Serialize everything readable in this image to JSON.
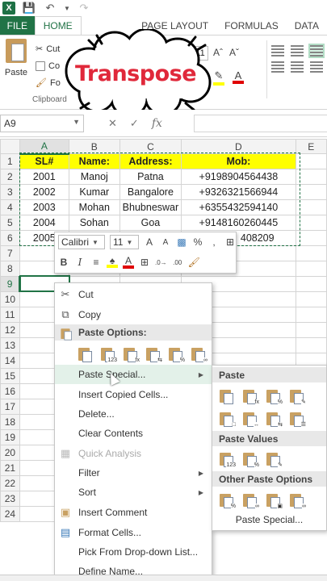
{
  "app": {
    "logo": "X"
  },
  "ribbon": {
    "tabs": [
      "FILE",
      "HOME",
      "PAGE LAYOUT",
      "FORMULAS",
      "DATA"
    ],
    "paste_label": "Paste",
    "clipboard_items": [
      "Cut",
      "Co",
      "Fo"
    ],
    "group_label": "Clipboard",
    "font_size_partial": "11"
  },
  "callout": {
    "text": "Transpose"
  },
  "formula_bar": {
    "namebox": "A9",
    "fx": "fx"
  },
  "sheet": {
    "columns": [
      "A",
      "B",
      "C",
      "D",
      "E"
    ],
    "rows": [
      "1",
      "2",
      "3",
      "4",
      "5",
      "6",
      "7",
      "8",
      "9",
      "10",
      "11",
      "12",
      "13",
      "14",
      "15",
      "16",
      "17",
      "18",
      "19",
      "20",
      "21",
      "22",
      "23",
      "24"
    ],
    "header": [
      "SL#",
      "Name:",
      "Address:",
      "Mob:"
    ],
    "data": [
      [
        "2001",
        "Manoj",
        "Patna",
        "+9198904564438"
      ],
      [
        "2002",
        "Kumar",
        "Bangalore",
        "+9326321566944"
      ],
      [
        "2003",
        "Mohan",
        "Bhubneswar",
        "+6355432594140"
      ],
      [
        "2004",
        "Sohan",
        "Goa",
        "+9148160260445"
      ],
      [
        "2005",
        "",
        "",
        "408209"
      ]
    ],
    "highlight_color": "#ffff00",
    "accent_color": "#217346"
  },
  "mini_toolbar": {
    "font": "Calibri",
    "size": "11",
    "grow": "A",
    "shrink": "A",
    "percent": "%",
    "comma": ",",
    "bold": "B",
    "italic": "I",
    "dec_inc": ".0→",
    "dec_dec": ".00"
  },
  "context_menu": {
    "cut": "Cut",
    "copy": "Copy",
    "paste_options": "Paste Options:",
    "paste_special": "Paste Special...",
    "insert_copied": "Insert Copied Cells...",
    "delete": "Delete...",
    "clear": "Clear Contents",
    "quick_analysis": "Quick Analysis",
    "filter": "Filter",
    "sort": "Sort",
    "insert_comment": "Insert Comment",
    "format_cells": "Format Cells...",
    "pick_list": "Pick From Drop-down List...",
    "define_name": "Define Name..."
  },
  "submenu": {
    "paste": "Paste",
    "paste_values": "Paste Values",
    "other": "Other Paste Options",
    "paste_special": "Paste Special..."
  }
}
